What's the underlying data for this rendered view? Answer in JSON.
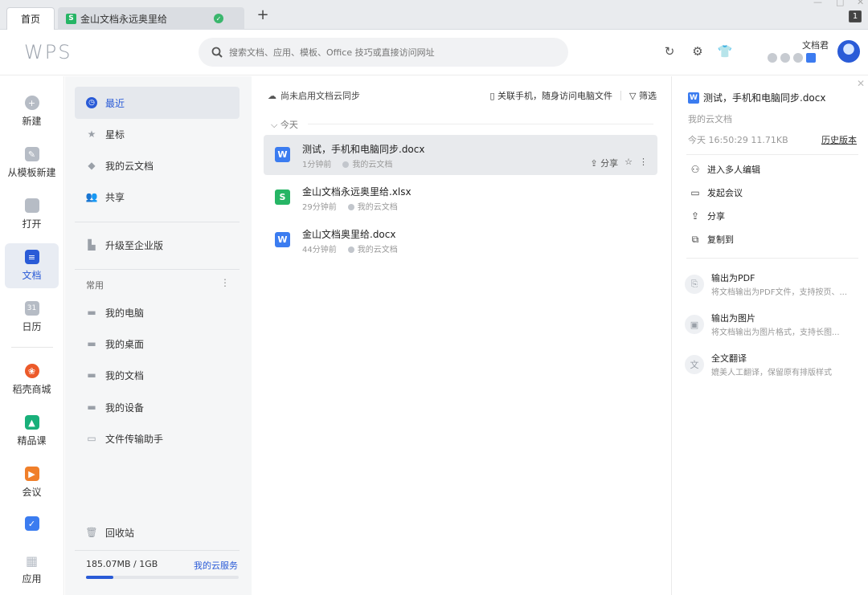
{
  "tabs": {
    "home": "首页",
    "doc": "金山文档永远奥里给",
    "count": "1"
  },
  "header": {
    "logo": "WPS",
    "search_placeholder": "搜索文档、应用、模板、Office 技巧或直接访问网址",
    "username": "文档君"
  },
  "leftnav": {
    "items": [
      {
        "label": "新建"
      },
      {
        "label": "从模板新建"
      },
      {
        "label": "打开"
      },
      {
        "label": "文档"
      },
      {
        "label": "日历"
      },
      {
        "label": "稻壳商城"
      },
      {
        "label": "精品课"
      },
      {
        "label": "会议"
      },
      {
        "label": "应用"
      }
    ],
    "calendar_day": "31"
  },
  "sidebar": {
    "items": [
      {
        "label": "最近"
      },
      {
        "label": "星标"
      },
      {
        "label": "我的云文档"
      },
      {
        "label": "共享"
      },
      {
        "label": "升级至企业版"
      }
    ],
    "group_label": "常用",
    "common": [
      {
        "label": "我的电脑"
      },
      {
        "label": "我的桌面"
      },
      {
        "label": "我的文档"
      },
      {
        "label": "我的设备"
      },
      {
        "label": "文件传输助手"
      }
    ],
    "trash": "回收站",
    "storage": "185.07MB / 1GB",
    "cloud_service": "我的云服务",
    "storage_fraction": 0.18
  },
  "main": {
    "sync_notice": "尚未启用文档云同步",
    "link_phone": "关联手机，随身访问电脑文件",
    "filter": "筛选",
    "section": "今天",
    "files": [
      {
        "name": "测试，手机和电脑同步.docx",
        "time": "1分钟前",
        "location": "我的云文档",
        "type": "W",
        "color": "#3b7cf0"
      },
      {
        "name": "金山文档永远奥里给.xlsx",
        "time": "29分钟前",
        "location": "我的云文档",
        "type": "S",
        "color": "#26b565"
      },
      {
        "name": "金山文档奥里给.docx",
        "time": "44分钟前",
        "location": "我的云文档",
        "type": "W",
        "color": "#3b7cf0"
      }
    ],
    "share": "分享"
  },
  "rpanel": {
    "filename": "测试，手机和电脑同步.docx",
    "location": "我的云文档",
    "time_size": "今天 16:50:29    11.71KB",
    "history": "历史版本",
    "actions": [
      {
        "label": "进入多人编辑"
      },
      {
        "label": "发起会议"
      },
      {
        "label": "分享"
      },
      {
        "label": "复制到"
      }
    ],
    "features": [
      {
        "title": "输出为PDF",
        "desc": "将文档输出为PDF文件，支持按页、..."
      },
      {
        "title": "输出为图片",
        "desc": "将文档输出为图片格式，支持长图..."
      },
      {
        "title": "全文翻译",
        "desc": "媲美人工翻译，保留原有排版样式"
      }
    ]
  }
}
